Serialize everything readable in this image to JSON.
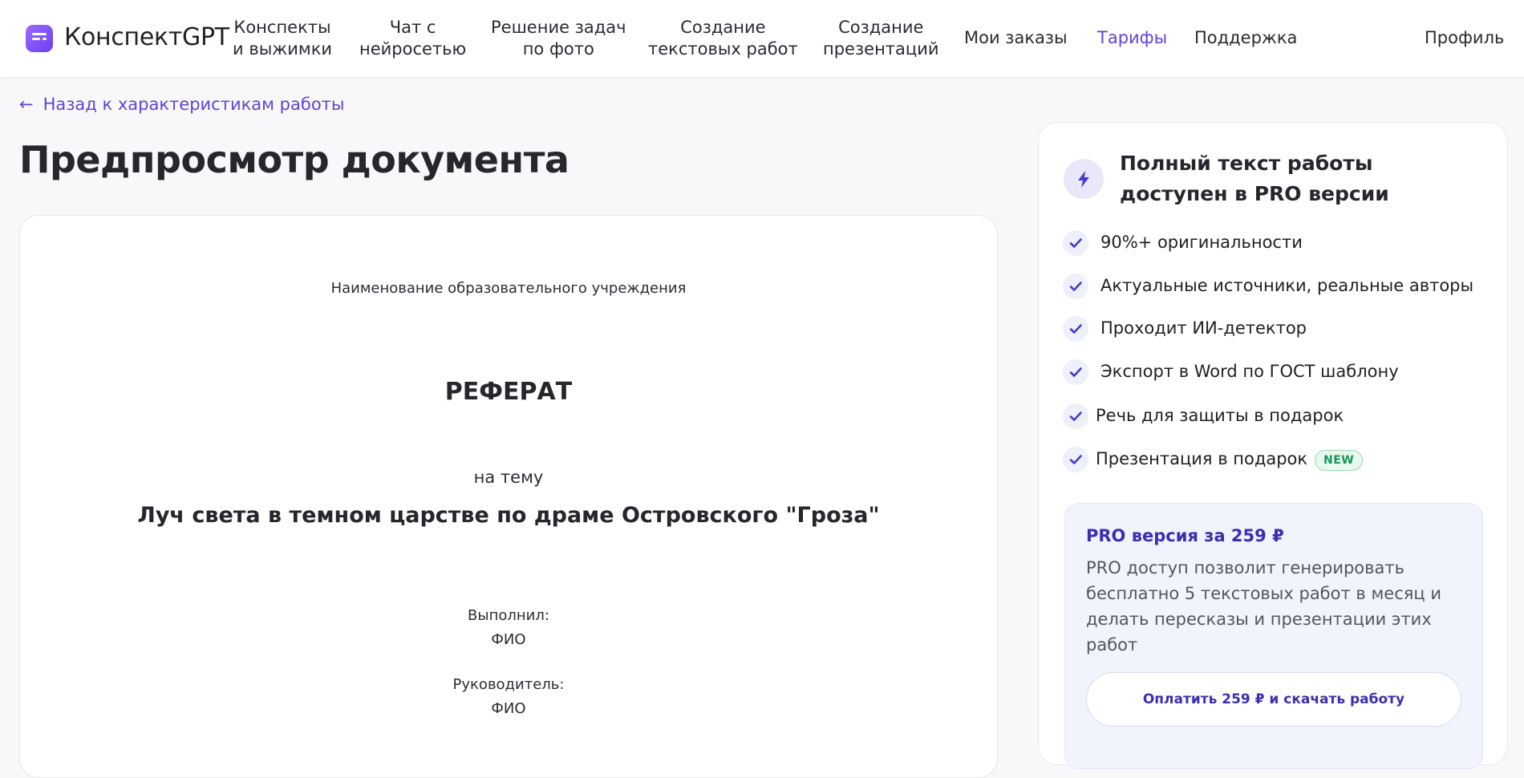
{
  "header": {
    "brand": "КонспектGPT",
    "nav": [
      {
        "line1": "Конспекты",
        "line2": "и выжимки"
      },
      {
        "line1": "Чат с",
        "line2": "нейросетью"
      },
      {
        "line1": "Решение задач",
        "line2": "по фото"
      },
      {
        "line1": "Создание",
        "line2": "текстовых работ"
      },
      {
        "line1": "Создание",
        "line2": "презентаций"
      },
      {
        "line1": "Мои заказы"
      },
      {
        "line1": "Тарифы",
        "active": true
      },
      {
        "line1": "Поддержка"
      },
      {
        "line1": "Профиль"
      }
    ],
    "accent_color": "#5b46d8"
  },
  "back_link": {
    "arrow": "←",
    "label": "Назад к характеристикам работы"
  },
  "page_title": "Предпросмотр документа",
  "document": {
    "institution": "Наименование образовательного учреждения",
    "type": "РЕФЕРАТ",
    "on_theme": "на тему",
    "topic": "Луч света в темном царстве по драме Островского \"Гроза\"",
    "performed_label": "Выполнил:",
    "performed_name": "ФИО",
    "supervisor_label": "Руководитель:",
    "supervisor_name": "ФИО"
  },
  "panel": {
    "title": "Полный текст работы доступен в PRO версии",
    "features": [
      {
        "label": "90%+ оригинальности"
      },
      {
        "label": "Актуальные источники, реальные авторы"
      },
      {
        "label": "Проходит ИИ-детектор"
      },
      {
        "label": "Экспорт в Word по ГОСТ шаблону"
      },
      {
        "label": "Речь для защиты в подарок"
      },
      {
        "label": "Презентация в подарок",
        "badge": "NEW"
      }
    ],
    "pro": {
      "title": "PRO версия за 259 ₽",
      "description": "PRO доступ позволит генерировать бесплатно 5 текстовых работ в месяц и делать пересказы и презентации этих работ",
      "button": "Оплатить 259 ₽ и скачать работу"
    }
  }
}
